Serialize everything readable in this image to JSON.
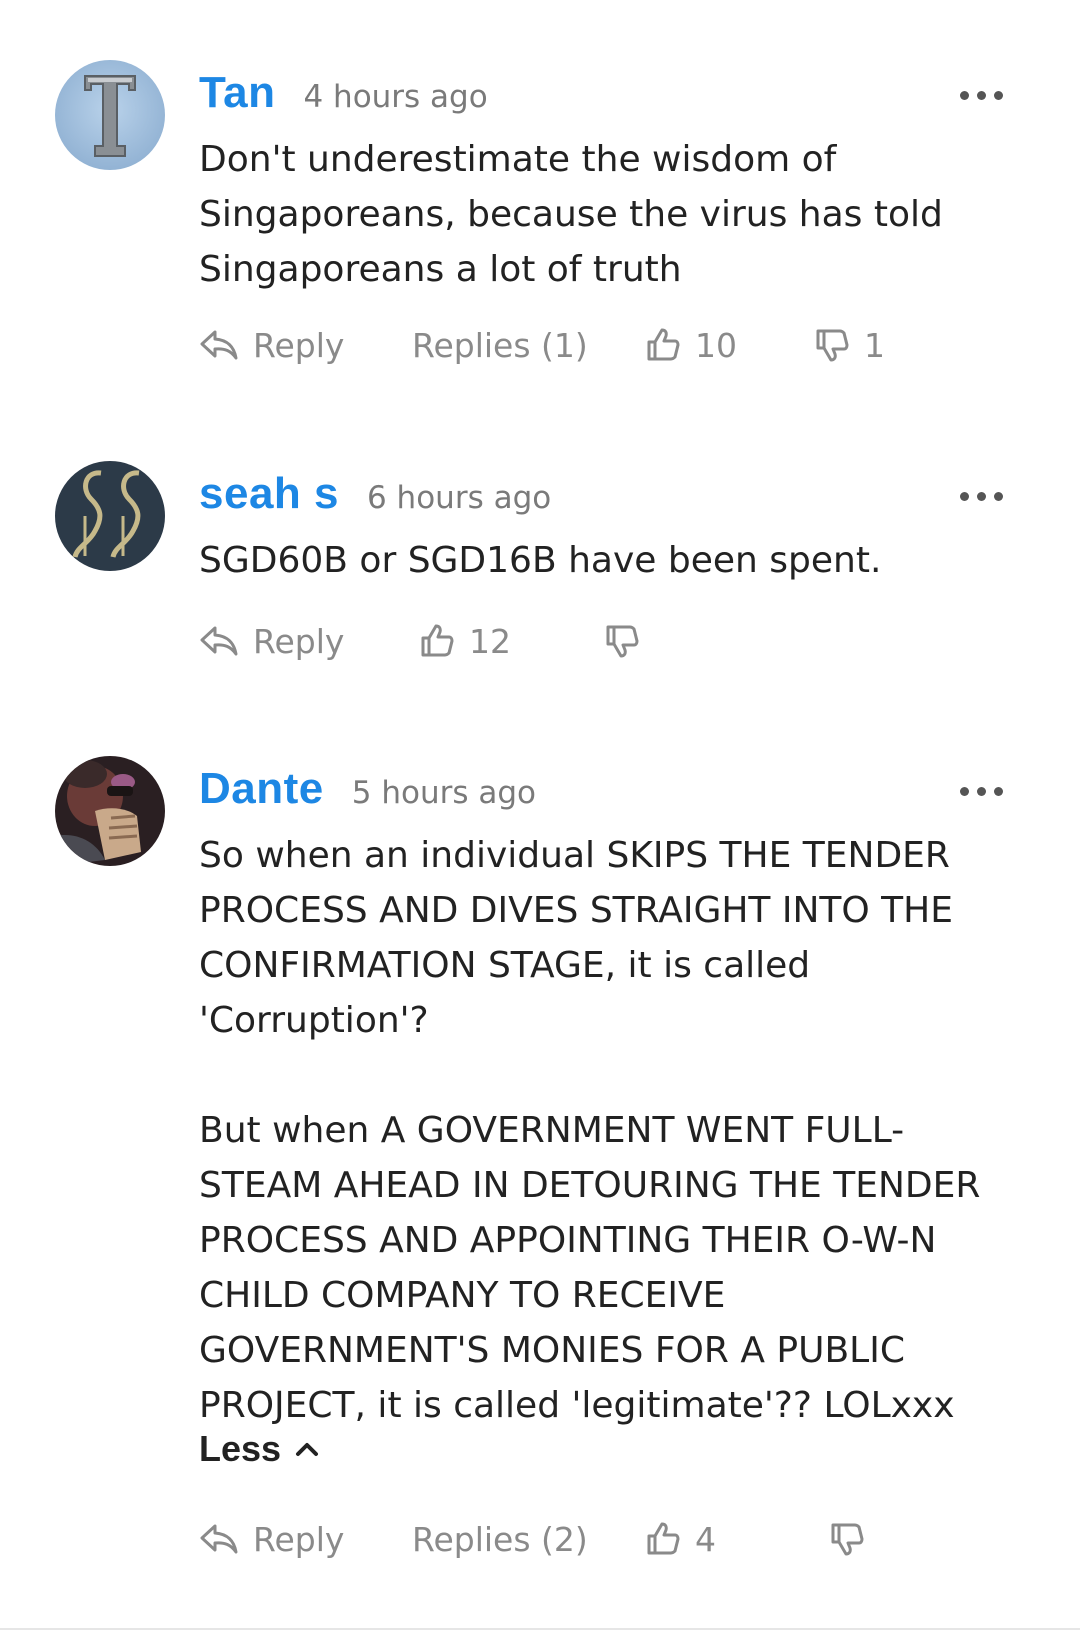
{
  "comments": [
    {
      "author": "Tan",
      "time": "4 hours ago",
      "text": "Don't underestimate the wisdom of Singaporeans, because the virus has told Singaporeans a lot of truth",
      "reply_label": "Reply",
      "replies_label": "Replies (1)",
      "likes": "10",
      "dislikes": "1",
      "avatar_letter": "T"
    },
    {
      "author": "seah s",
      "time": "6 hours ago",
      "text": "SGD60B or SGD16B have been spent.",
      "reply_label": "Reply",
      "likes": "12",
      "avatar_letter": "SS"
    },
    {
      "author": "Dante",
      "time": "5 hours ago",
      "text": "So when an individual SKIPS THE TENDER PROCESS AND DIVES STRAIGHT INTO THE CONFIRMATION STAGE, it is called 'Corruption'?\n\nBut when A GOVERNMENT WENT FULL-STEAM AHEAD IN DETOURING THE TENDER PROCESS AND APPOINTING THEIR O-W-N CHILD COMPANY TO RECEIVE GOVERNMENT'S MONIES FOR A PUBLIC PROJECT, it is called 'legitimate'?? LOLxxx",
      "less_label": "Less",
      "reply_label": "Reply",
      "replies_label": "Replies (2)",
      "likes": "4"
    }
  ],
  "icons": {
    "reply": "reply-arrow-icon",
    "like": "thumbs-up-icon",
    "dislike": "thumbs-down-icon",
    "more": "more-dots-icon",
    "less": "chevron-up-icon"
  },
  "colors": {
    "author": "#1d87e4",
    "meta": "#7a7a7a",
    "action": "#8a8a8a",
    "text": "#222222"
  }
}
